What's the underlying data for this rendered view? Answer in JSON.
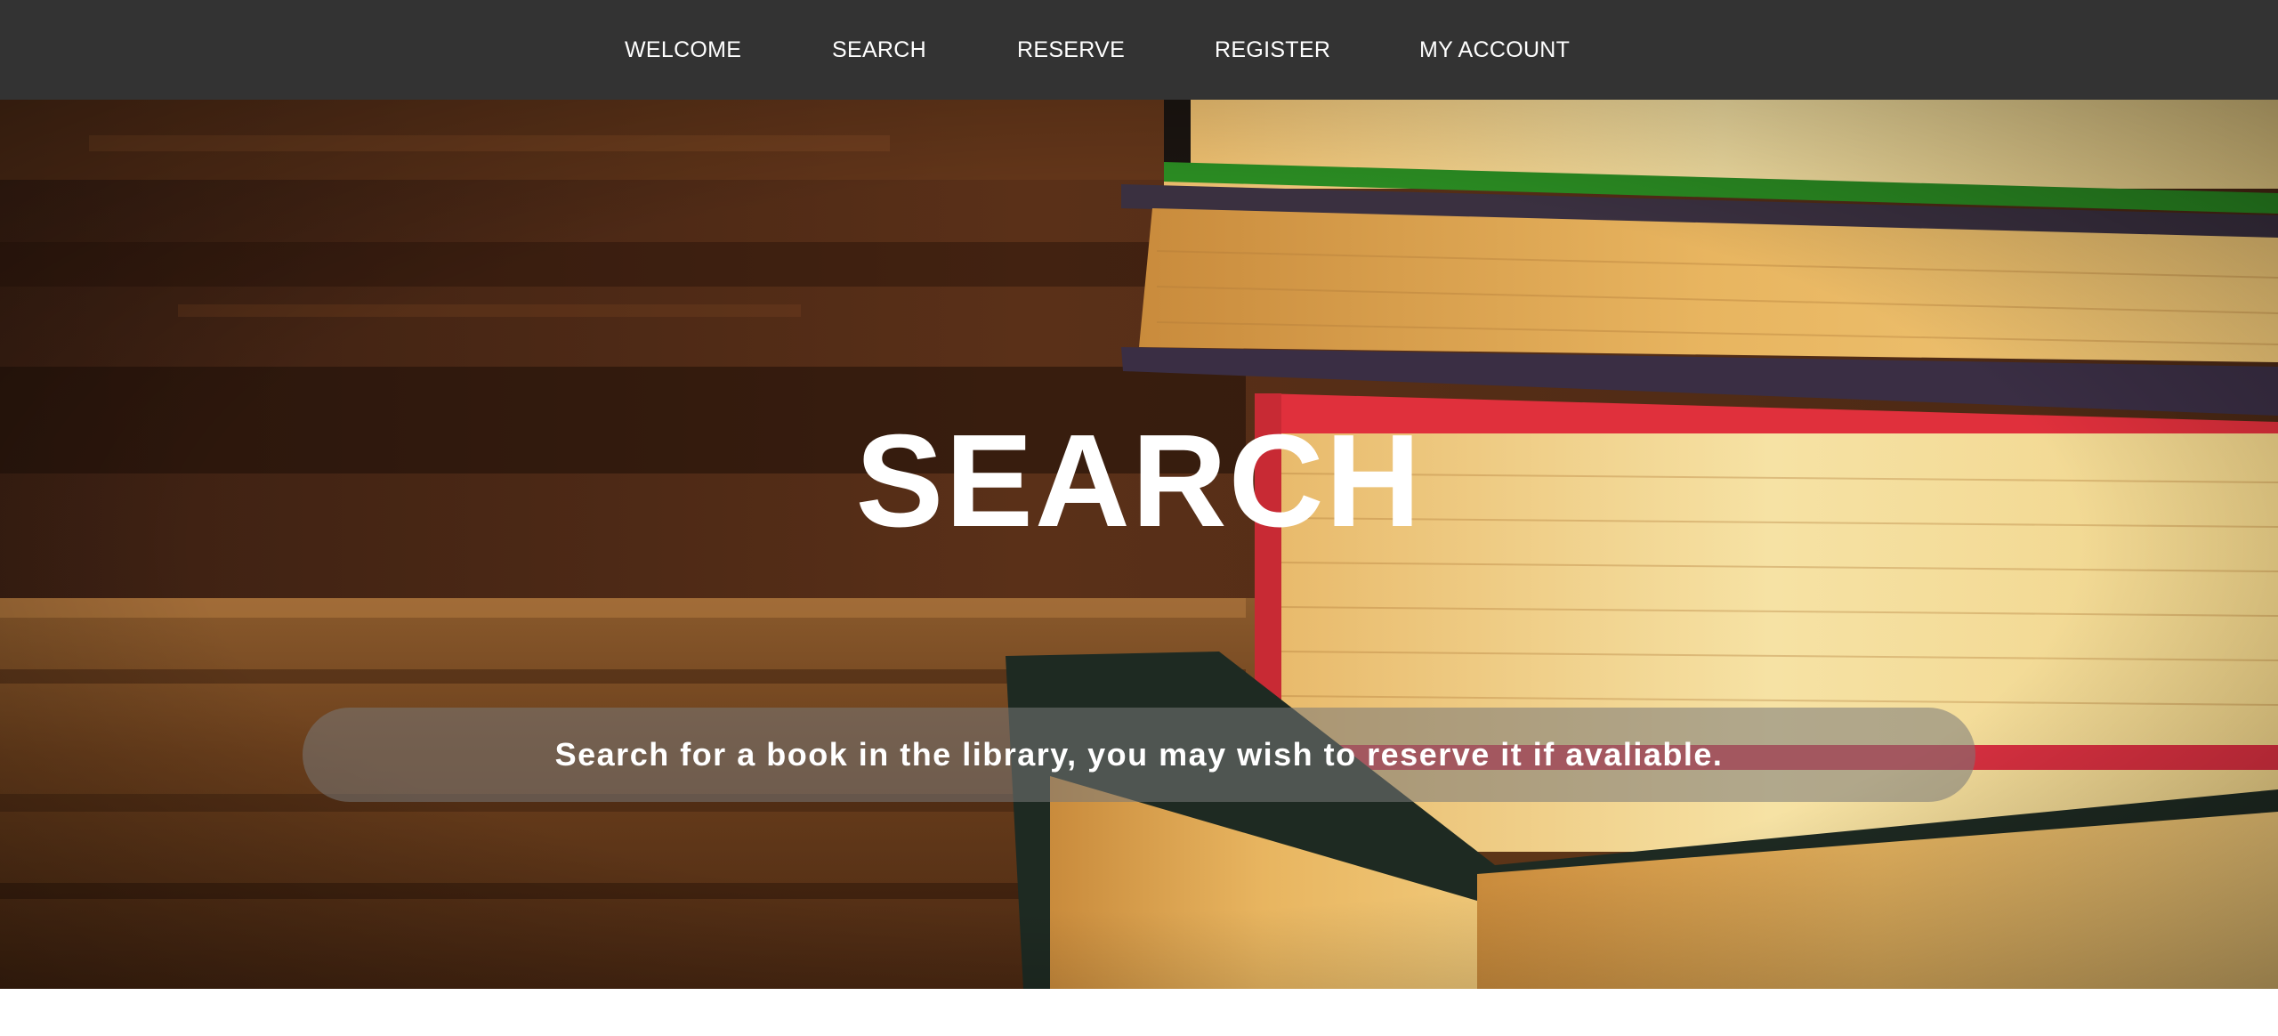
{
  "nav": {
    "items": [
      {
        "label": "WELCOME"
      },
      {
        "label": "SEARCH"
      },
      {
        "label": "RESERVE"
      },
      {
        "label": "REGISTER"
      },
      {
        "label": "MY ACCOUNT"
      }
    ]
  },
  "hero": {
    "title": "SEARCH",
    "subtitle": "Search for a book in the library, you may wish to reserve it if avaliable."
  },
  "colors": {
    "nav_bg": "#333333",
    "nav_text": "#ffffff",
    "hero_text": "#ffffff"
  }
}
